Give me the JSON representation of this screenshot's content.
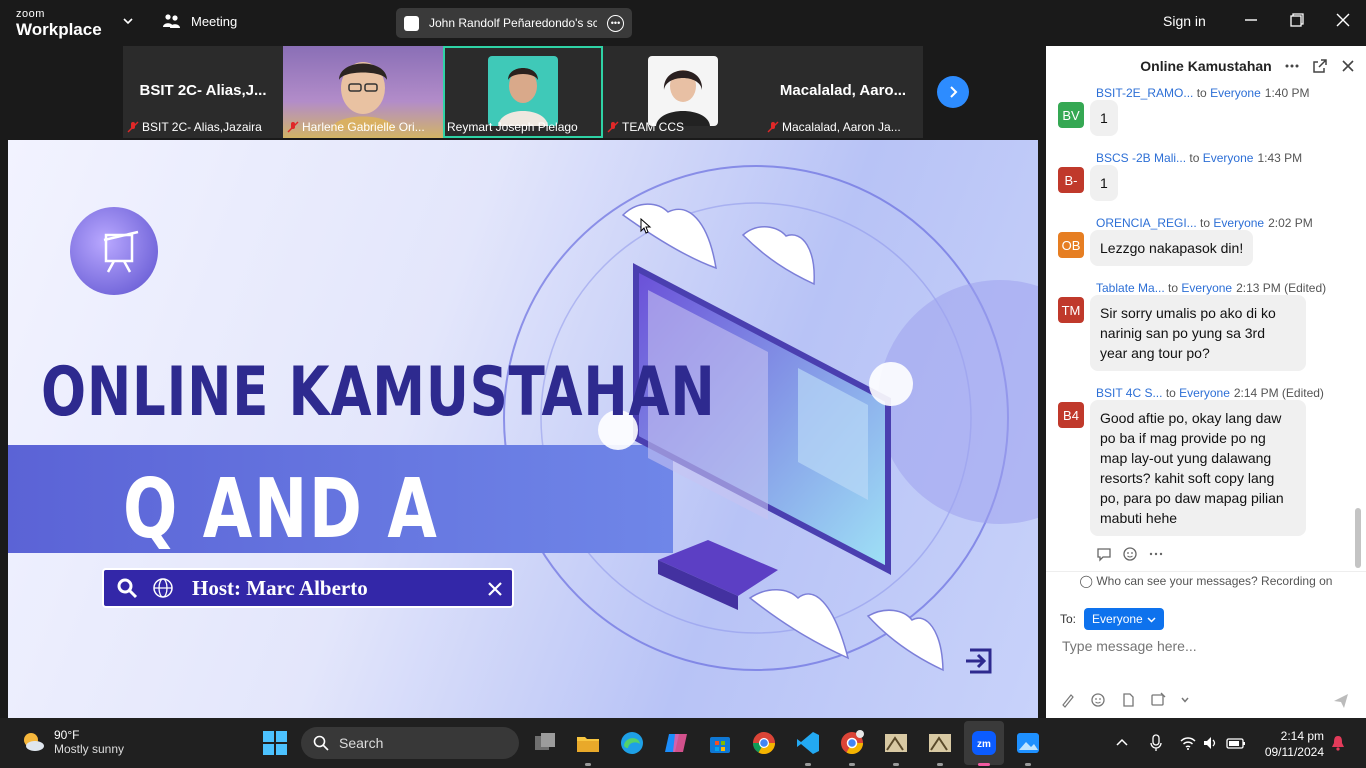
{
  "topbar": {
    "logo_top": "zoom",
    "logo_bottom": "Workplace",
    "meeting_label": "Meeting",
    "share_title": "John Randolf Peñaredondo's scre",
    "sign_in": "Sign in"
  },
  "participants": [
    {
      "big_name": "BSIT 2C- Alias,J...",
      "label": "BSIT 2C- Alias,Jazaira",
      "muted": true,
      "video": false
    },
    {
      "big_name": "",
      "label": "Harlene Gabrielle Ori...",
      "muted": true,
      "video": true
    },
    {
      "big_name": "",
      "label": "Reymart Joseph Pielago",
      "muted": false,
      "video": true,
      "active": true
    },
    {
      "big_name": "",
      "label": "TEAM CCS",
      "muted": true,
      "video": true
    },
    {
      "big_name": "Macalalad,  Aaro...",
      "label": "Macalalad, Aaron Ja...",
      "muted": true,
      "video": false
    }
  ],
  "slide": {
    "title_line1": "ONLINE KAMUSTAHAN",
    "title_line2": "Q AND A",
    "host": "Host: Marc Alberto"
  },
  "chat": {
    "title": "Online Kamustahan",
    "messages": [
      {
        "initials": "BV",
        "avatar_color": "#35a853",
        "sender": "BSIT-2E_RAMO...",
        "to": "to",
        "recipient": "Everyone",
        "time": "1:40 PM",
        "text": "1"
      },
      {
        "initials": "B-",
        "avatar_color": "#c0392b",
        "sender": "BSCS -2B Mali...",
        "to": "to",
        "recipient": "Everyone",
        "time": "1:43 PM",
        "text": "1"
      },
      {
        "initials": "OB",
        "avatar_color": "#e67e22",
        "sender": "ORENCIA_REGI...",
        "to": "to",
        "recipient": "Everyone",
        "time": "2:02 PM",
        "text": "Lezzgo nakapasok din!"
      },
      {
        "initials": "TM",
        "avatar_color": "#c0392b",
        "sender": "Tablate Ma...",
        "to": "to",
        "recipient": "Everyone",
        "time": "2:13 PM (Edited)",
        "text": "Sir sorry umalis po ako di ko narinig san po yung sa 3rd year ang tour po?"
      },
      {
        "initials": "B4",
        "avatar_color": "#c0392b",
        "sender": "BSIT 4C S...",
        "to": "to",
        "recipient": "Everyone",
        "time": "2:14 PM (Edited)",
        "text": "Good aftie po, okay lang daw po ba if mag provide po ng map lay-out yung dalawang resorts? kahit soft copy lang po, para po daw mapag pilian mabuti hehe"
      }
    ],
    "visibility_note": "Who can see your messages? Recording on",
    "to_label": "To:",
    "recipient_select": "Everyone",
    "input_placeholder": "Type message here..."
  },
  "taskbar": {
    "temperature": "90°F",
    "condition": "Mostly sunny",
    "search_label": "Search",
    "time": "2:14 pm",
    "date": "09/11/2024"
  },
  "colors": {
    "zoom_blue": "#0e72ed",
    "active_tile_border": "#2fd3a6",
    "slide_purple": "#2e2a8f"
  }
}
